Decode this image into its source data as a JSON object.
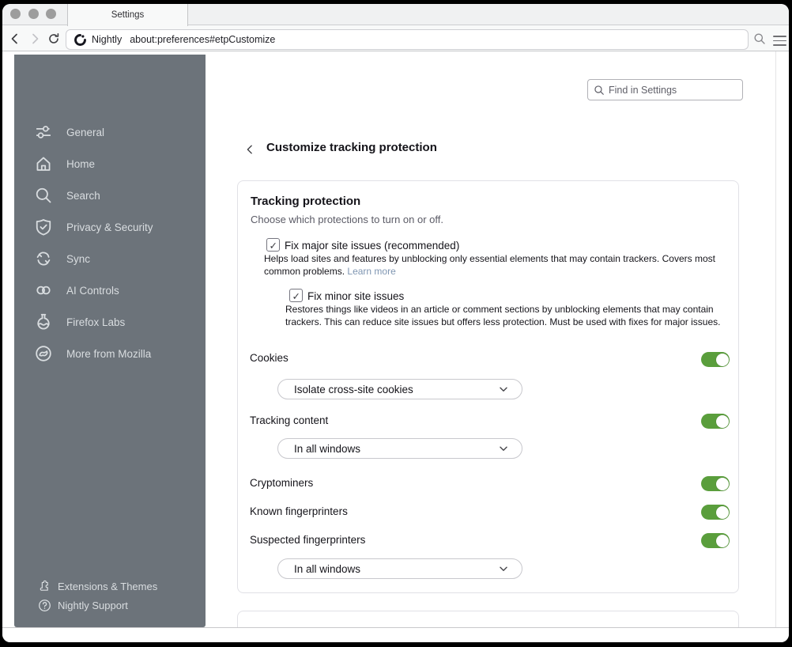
{
  "colors": {
    "toggle_green": "#5a9e3c",
    "link": "#7f96b2",
    "sidebar_bg": "#6c737a",
    "sidebar_text": "#d9dde0"
  },
  "browser": {
    "tab_title": "Settings",
    "url_prefix": "Nightly",
    "url": "about:preferences#etpCustomize",
    "icons": {
      "back": "chevron-left",
      "forward": "chevron-right",
      "reload": "refresh-arrow",
      "identity": "nightly-logo",
      "search": "magnifier",
      "menu": "hamburger"
    }
  },
  "settings": {
    "search_placeholder": "Find in Settings",
    "page_title": "Customize tracking protection",
    "sidebar": {
      "items": [
        {
          "label": "General",
          "icon": "sliders-icon"
        },
        {
          "label": "Home",
          "icon": "home-icon"
        },
        {
          "label": "Search",
          "icon": "search-icon"
        },
        {
          "label": "Privacy & Security",
          "icon": "shield-check-icon"
        },
        {
          "label": "Sync",
          "icon": "sync-icon"
        },
        {
          "label": "AI Controls",
          "icon": "loops-icon"
        },
        {
          "label": "Firefox Labs",
          "icon": "flask-icon"
        },
        {
          "label": "More from Mozilla",
          "icon": "globe-icon"
        }
      ],
      "footer_items": [
        {
          "label": "Extensions & Themes",
          "icon": "puzzle-icon"
        },
        {
          "label": "Nightly Support",
          "icon": "question-icon"
        }
      ]
    },
    "card": {
      "heading": "Tracking protection",
      "subheading": "Choose which protections to turn on or off.",
      "fix_major": {
        "label": "Fix major site issues (recommended)",
        "checked": true,
        "description": "Helps load sites and features by unblocking only essential elements that may contain trackers. Covers most common problems.",
        "link_label": "Learn more"
      },
      "fix_minor": {
        "label": "Fix minor site issues",
        "checked": true,
        "description": "Restores things like videos in an article or comment sections by unblocking elements that may contain trackers. This can reduce site issues but offers less protection. Must be used with fixes for major issues."
      },
      "rows": [
        {
          "label": "Cookies",
          "toggle_on": true,
          "dropdown_value": "Isolate cross-site cookies"
        },
        {
          "label": "Tracking content",
          "toggle_on": true,
          "dropdown_value": "In all windows"
        },
        {
          "label": "Cryptominers",
          "toggle_on": true
        },
        {
          "label": "Known fingerprinters",
          "toggle_on": true
        },
        {
          "label": "Suspected fingerprinters",
          "toggle_on": true,
          "dropdown_value": "In all windows"
        }
      ]
    }
  }
}
